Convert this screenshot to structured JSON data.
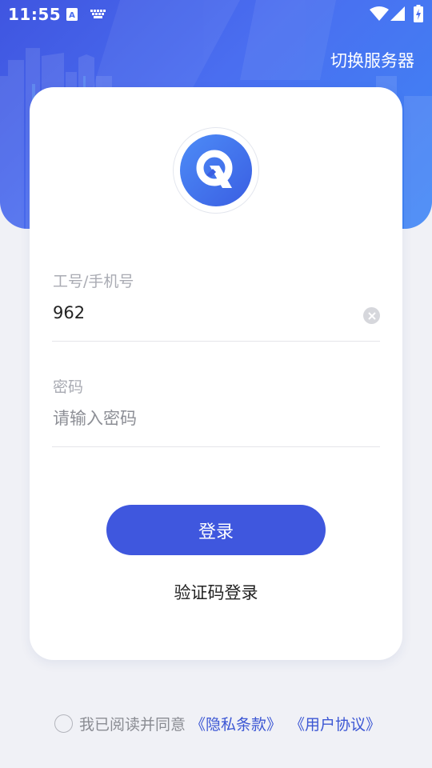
{
  "status_bar": {
    "time": "11:55"
  },
  "header": {
    "switch_server_label": "切换服务器"
  },
  "login_form": {
    "account_label": "工号/手机号",
    "account_value": "962",
    "password_label": "密码",
    "password_placeholder": "请输入密码",
    "login_button_label": "登录",
    "code_login_label": "验证码登录"
  },
  "agreement": {
    "text": "我已阅读并同意",
    "privacy_link": "《隐私条款》",
    "user_agreement_link": "《用户协议》",
    "checked": false
  },
  "colors": {
    "primary": "#3f57de",
    "header_gradient_start": "#3f55e0",
    "header_gradient_end": "#3f86f5",
    "link": "#3c57d4",
    "background": "#f0f1f6"
  },
  "icons": [
    "keyboard-a-icon",
    "keyboard-icon",
    "wifi-icon",
    "signal-icon",
    "battery-icon",
    "app-logo-icon",
    "clear-icon",
    "radio-unchecked-icon"
  ]
}
